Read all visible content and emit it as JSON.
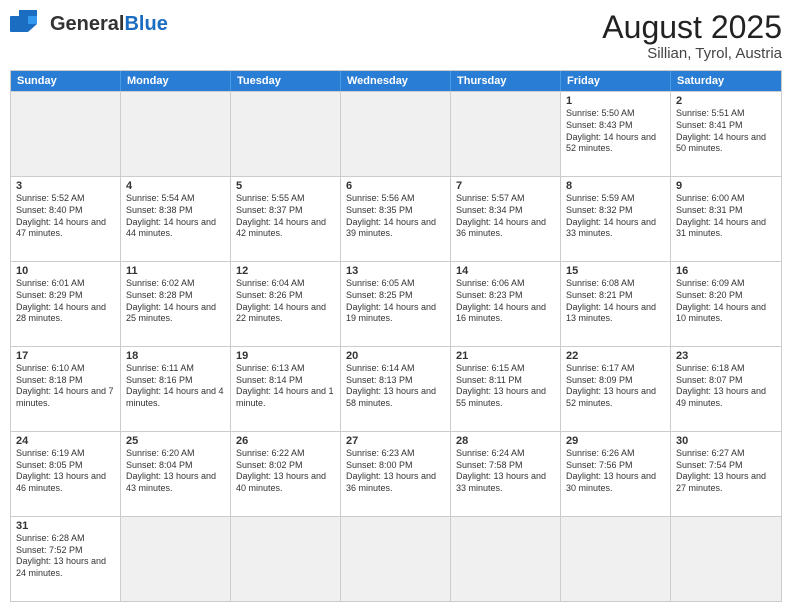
{
  "header": {
    "logo_general": "General",
    "logo_blue": "Blue",
    "month_title": "August 2025",
    "location": "Sillian, Tyrol, Austria"
  },
  "days_of_week": [
    "Sunday",
    "Monday",
    "Tuesday",
    "Wednesday",
    "Thursday",
    "Friday",
    "Saturday"
  ],
  "weeks": [
    {
      "cells": [
        {
          "day": "",
          "empty": true
        },
        {
          "day": "",
          "empty": true
        },
        {
          "day": "",
          "empty": true
        },
        {
          "day": "",
          "empty": true
        },
        {
          "day": "",
          "empty": true
        },
        {
          "day": "1",
          "sunrise": "5:50 AM",
          "sunset": "8:43 PM",
          "daylight": "14 hours and 52 minutes."
        },
        {
          "day": "2",
          "sunrise": "5:51 AM",
          "sunset": "8:41 PM",
          "daylight": "14 hours and 50 minutes."
        }
      ]
    },
    {
      "cells": [
        {
          "day": "3",
          "sunrise": "5:52 AM",
          "sunset": "8:40 PM",
          "daylight": "14 hours and 47 minutes."
        },
        {
          "day": "4",
          "sunrise": "5:54 AM",
          "sunset": "8:38 PM",
          "daylight": "14 hours and 44 minutes."
        },
        {
          "day": "5",
          "sunrise": "5:55 AM",
          "sunset": "8:37 PM",
          "daylight": "14 hours and 42 minutes."
        },
        {
          "day": "6",
          "sunrise": "5:56 AM",
          "sunset": "8:35 PM",
          "daylight": "14 hours and 39 minutes."
        },
        {
          "day": "7",
          "sunrise": "5:57 AM",
          "sunset": "8:34 PM",
          "daylight": "14 hours and 36 minutes."
        },
        {
          "day": "8",
          "sunrise": "5:59 AM",
          "sunset": "8:32 PM",
          "daylight": "14 hours and 33 minutes."
        },
        {
          "day": "9",
          "sunrise": "6:00 AM",
          "sunset": "8:31 PM",
          "daylight": "14 hours and 31 minutes."
        }
      ]
    },
    {
      "cells": [
        {
          "day": "10",
          "sunrise": "6:01 AM",
          "sunset": "8:29 PM",
          "daylight": "14 hours and 28 minutes."
        },
        {
          "day": "11",
          "sunrise": "6:02 AM",
          "sunset": "8:28 PM",
          "daylight": "14 hours and 25 minutes."
        },
        {
          "day": "12",
          "sunrise": "6:04 AM",
          "sunset": "8:26 PM",
          "daylight": "14 hours and 22 minutes."
        },
        {
          "day": "13",
          "sunrise": "6:05 AM",
          "sunset": "8:25 PM",
          "daylight": "14 hours and 19 minutes."
        },
        {
          "day": "14",
          "sunrise": "6:06 AM",
          "sunset": "8:23 PM",
          "daylight": "14 hours and 16 minutes."
        },
        {
          "day": "15",
          "sunrise": "6:08 AM",
          "sunset": "8:21 PM",
          "daylight": "14 hours and 13 minutes."
        },
        {
          "day": "16",
          "sunrise": "6:09 AM",
          "sunset": "8:20 PM",
          "daylight": "14 hours and 10 minutes."
        }
      ]
    },
    {
      "cells": [
        {
          "day": "17",
          "sunrise": "6:10 AM",
          "sunset": "8:18 PM",
          "daylight": "14 hours and 7 minutes."
        },
        {
          "day": "18",
          "sunrise": "6:11 AM",
          "sunset": "8:16 PM",
          "daylight": "14 hours and 4 minutes."
        },
        {
          "day": "19",
          "sunrise": "6:13 AM",
          "sunset": "8:14 PM",
          "daylight": "14 hours and 1 minute."
        },
        {
          "day": "20",
          "sunrise": "6:14 AM",
          "sunset": "8:13 PM",
          "daylight": "13 hours and 58 minutes."
        },
        {
          "day": "21",
          "sunrise": "6:15 AM",
          "sunset": "8:11 PM",
          "daylight": "13 hours and 55 minutes."
        },
        {
          "day": "22",
          "sunrise": "6:17 AM",
          "sunset": "8:09 PM",
          "daylight": "13 hours and 52 minutes."
        },
        {
          "day": "23",
          "sunrise": "6:18 AM",
          "sunset": "8:07 PM",
          "daylight": "13 hours and 49 minutes."
        }
      ]
    },
    {
      "cells": [
        {
          "day": "24",
          "sunrise": "6:19 AM",
          "sunset": "8:05 PM",
          "daylight": "13 hours and 46 minutes."
        },
        {
          "day": "25",
          "sunrise": "6:20 AM",
          "sunset": "8:04 PM",
          "daylight": "13 hours and 43 minutes."
        },
        {
          "day": "26",
          "sunrise": "6:22 AM",
          "sunset": "8:02 PM",
          "daylight": "13 hours and 40 minutes."
        },
        {
          "day": "27",
          "sunrise": "6:23 AM",
          "sunset": "8:00 PM",
          "daylight": "13 hours and 36 minutes."
        },
        {
          "day": "28",
          "sunrise": "6:24 AM",
          "sunset": "7:58 PM",
          "daylight": "13 hours and 33 minutes."
        },
        {
          "day": "29",
          "sunrise": "6:26 AM",
          "sunset": "7:56 PM",
          "daylight": "13 hours and 30 minutes."
        },
        {
          "day": "30",
          "sunrise": "6:27 AM",
          "sunset": "7:54 PM",
          "daylight": "13 hours and 27 minutes."
        }
      ]
    },
    {
      "cells": [
        {
          "day": "31",
          "sunrise": "6:28 AM",
          "sunset": "7:52 PM",
          "daylight": "13 hours and 24 minutes."
        },
        {
          "day": "",
          "empty": true
        },
        {
          "day": "",
          "empty": true
        },
        {
          "day": "",
          "empty": true
        },
        {
          "day": "",
          "empty": true
        },
        {
          "day": "",
          "empty": true
        },
        {
          "day": "",
          "empty": true
        }
      ]
    }
  ]
}
